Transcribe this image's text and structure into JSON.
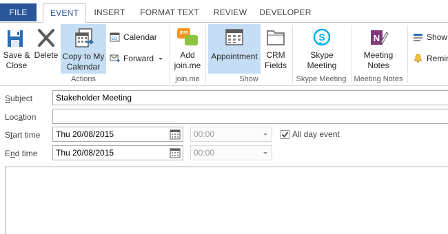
{
  "tabs": [
    {
      "label": "FILE"
    },
    {
      "label": "EVENT"
    },
    {
      "label": "INSERT"
    },
    {
      "label": "FORMAT TEXT"
    },
    {
      "label": "REVIEW"
    },
    {
      "label": "DEVELOPER"
    }
  ],
  "ribbon": {
    "save_close": "Save &\nClose",
    "delete": "Delete",
    "copy_to_calendar": "Copy to My\nCalendar",
    "calendar": "Calendar",
    "forward": "Forward",
    "add_joinme": "Add\njoin.me",
    "appointment": "Appointment",
    "crm_fields": "CRM\nFields",
    "skype_meeting": "Skype\nMeeting",
    "meeting_notes": "Meeting\nNotes",
    "show": "Show",
    "reminder": "Remin",
    "groups": {
      "actions": "Actions",
      "joinme": "join.me",
      "show": "Show",
      "skype": "Skype Meeting",
      "notes": "Meeting Notes"
    },
    "joinme_badge": "join me"
  },
  "form": {
    "subject_label_key": "S",
    "subject_label_rest": "ubject",
    "subject_value": "Stakeholder Meeting",
    "location_label_pre": "Loc",
    "location_label_key": "a",
    "location_label_rest": "tion",
    "location_value": "",
    "start_label_pre": "S",
    "start_label_key": "t",
    "start_label_rest": "art time",
    "start_date": "Thu 20/08/2015",
    "start_time": "00:00",
    "end_label_pre": "E",
    "end_label_key": "n",
    "end_label_rest": "d time",
    "end_date": "Thu 20/08/2015",
    "end_time": "00:00",
    "all_day_label": "All day event",
    "all_day_checked": true
  },
  "colors": {
    "file_tab": "#2b579a",
    "selected_button": "#c5def5",
    "onenote_purple": "#80397b",
    "skype_blue": "#00aff0",
    "joinme_green": "#8bc53f",
    "joinme_orange": "#f7941d"
  }
}
